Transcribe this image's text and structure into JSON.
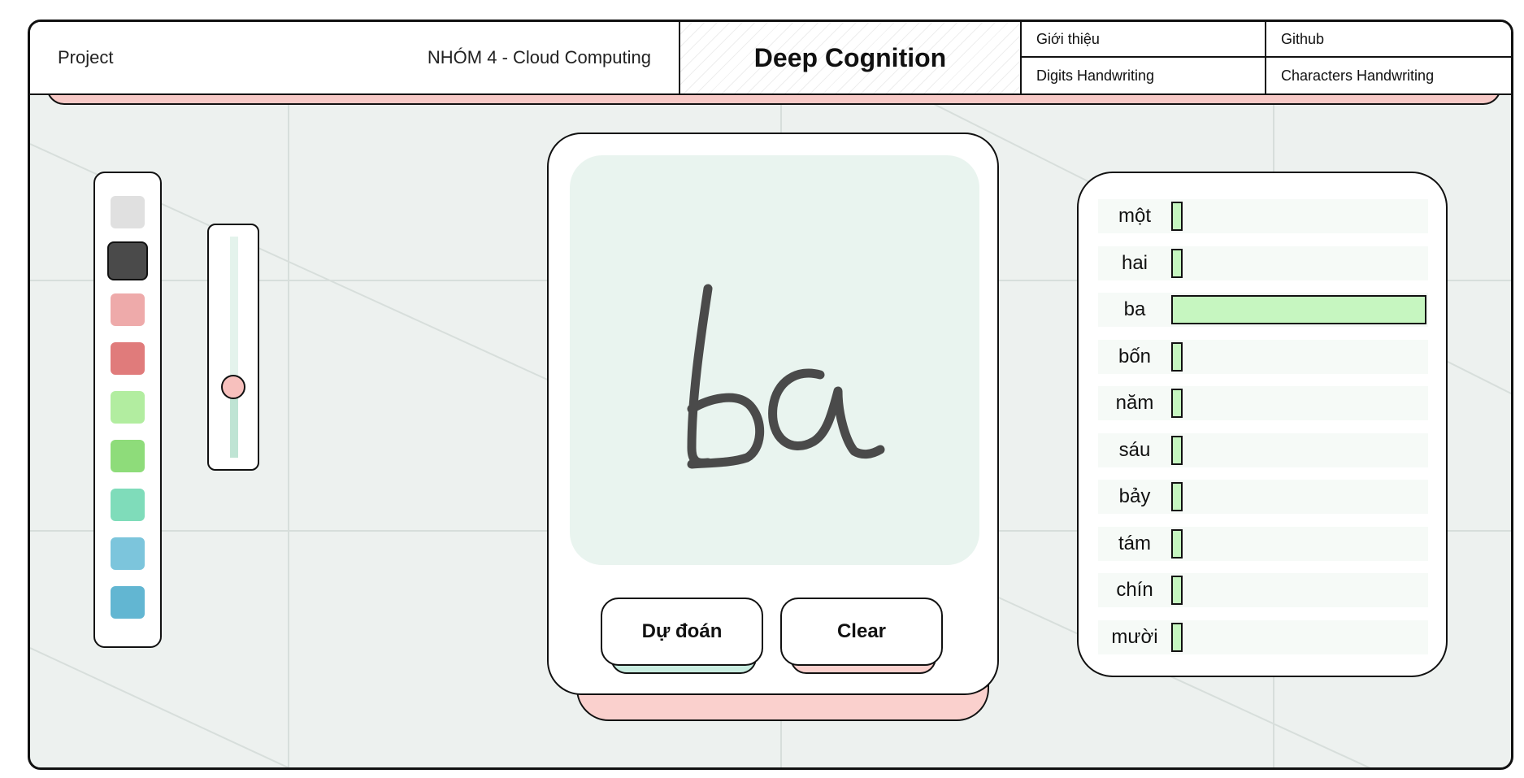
{
  "header": {
    "left_label": "Project",
    "group_label": "NHÓM 4 - Cloud Computing",
    "brand": "Deep Cognition",
    "links": {
      "intro": "Giới thiệu",
      "github": "Github",
      "digits": "Digits Handwriting",
      "characters": "Characters Handwriting"
    }
  },
  "palette": {
    "colors": [
      "#e0e0e0",
      "#4a4a4a",
      "#eeaaaa",
      "#e07b7b",
      "#b2eda0",
      "#8edc7a",
      "#7fdcba",
      "#7cc5dc",
      "#62b6d2"
    ],
    "selected_index": 1
  },
  "brush_size": {
    "level": 0.32
  },
  "canvas": {
    "stroke_color": "#4a4a4a"
  },
  "buttons": {
    "predict": "Dự đoán",
    "clear": "Clear"
  },
  "accents": {
    "predict_shadow": "#c8ece0",
    "clear_shadow": "#fad0cd",
    "bar": "#c6f6c0"
  },
  "predictions": [
    {
      "label": "một",
      "score": 0.01
    },
    {
      "label": "hai",
      "score": 0.01
    },
    {
      "label": "ba",
      "score": 0.98
    },
    {
      "label": "bốn",
      "score": 0.01
    },
    {
      "label": "năm",
      "score": 0.01
    },
    {
      "label": "sáu",
      "score": 0.01
    },
    {
      "label": "bảy",
      "score": 0.01
    },
    {
      "label": "tám",
      "score": 0.01
    },
    {
      "label": "chín",
      "score": 0.01
    },
    {
      "label": "mười",
      "score": 0.01
    }
  ]
}
